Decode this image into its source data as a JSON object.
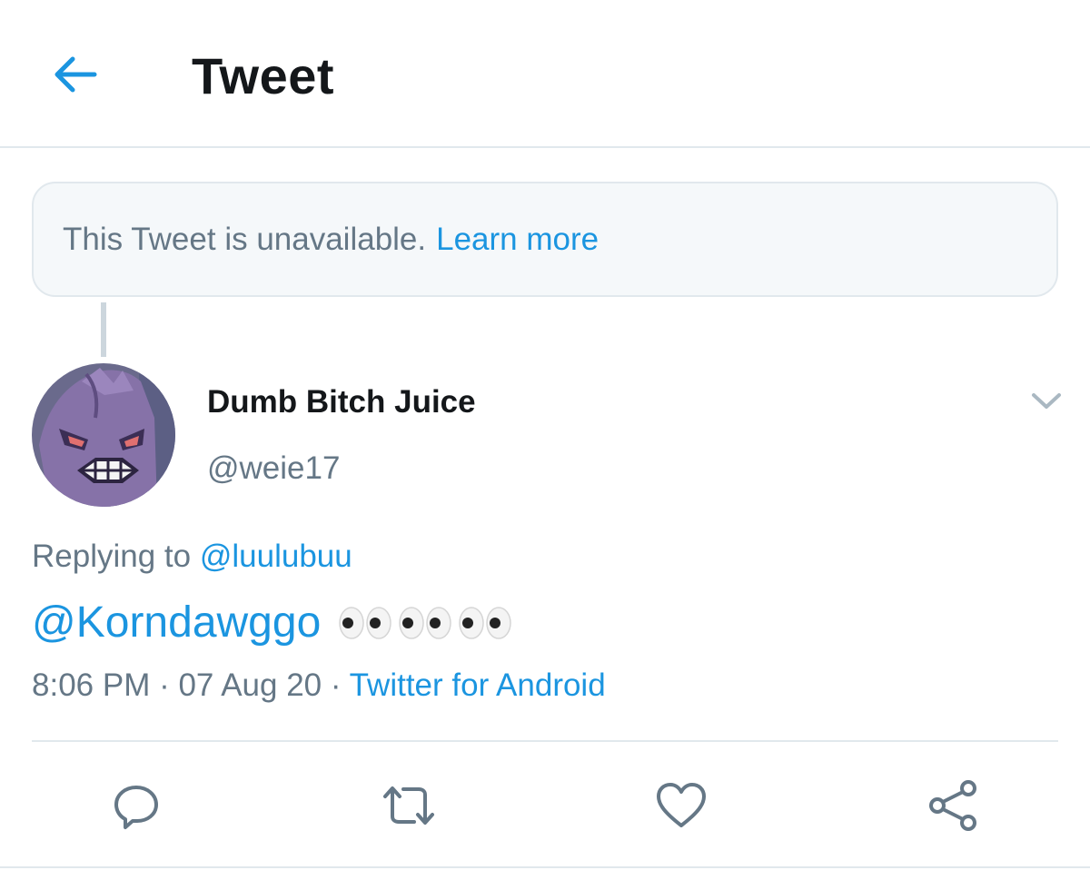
{
  "header": {
    "title": "Tweet",
    "back_icon": "arrow-left-icon"
  },
  "notice": {
    "text": "This Tweet is unavailable.",
    "link": "Learn more"
  },
  "tweet": {
    "author_name": "Dumb Bitch Juice",
    "author_handle": "@weie17",
    "replying_prefix": "Replying to",
    "replying_to": "@luulubuu",
    "mention": "@Korndawggo",
    "emoji": "eyes-emoji x3",
    "time": "8:06 PM",
    "separator1": " · ",
    "date": "07 Aug 20",
    "separator2": " · ",
    "source": "Twitter for Android"
  },
  "actions": {
    "reply_icon": "reply-icon",
    "retweet_icon": "retweet-icon",
    "like_icon": "heart-icon",
    "share_icon": "share-icon"
  },
  "colors": {
    "accent": "#1b95e0",
    "text_primary": "#14171a",
    "text_secondary": "#657786",
    "border": "#e1e8ed",
    "notice_bg": "#f5f8fa"
  }
}
